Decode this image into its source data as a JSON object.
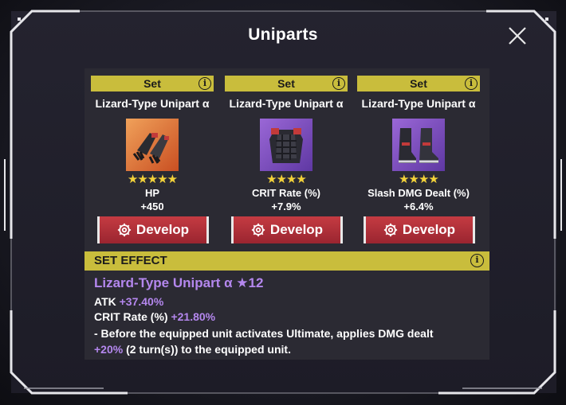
{
  "modal": {
    "title": "Uniparts",
    "close_icon": "close-icon"
  },
  "cards": [
    {
      "set_label": "Set",
      "name": "Lizard-Type Unipart α",
      "image": "gauntlet-icon",
      "stars": "★★★★★",
      "star_count": 5,
      "stat_name": "HP",
      "stat_value": "+450",
      "develop_label": "Develop"
    },
    {
      "set_label": "Set",
      "name": "Lizard-Type Unipart α",
      "image": "armor-icon",
      "stars": "★★★★",
      "star_count": 4,
      "stat_name": "CRIT Rate (%)",
      "stat_value": "+7.9%",
      "develop_label": "Develop"
    },
    {
      "set_label": "Set",
      "name": "Lizard-Type Unipart α",
      "image": "boots-icon",
      "stars": "★★★★",
      "star_count": 4,
      "stat_name": "Slash DMG Dealt (%)",
      "stat_value": "+6.4%",
      "develop_label": "Develop"
    }
  ],
  "set_effect": {
    "header": "SET EFFECT",
    "title": "Lizard-Type Unipart α ★12",
    "atk_label": "ATK",
    "atk_value": "+37.40%",
    "crit_label": "CRIT Rate (%)",
    "crit_value": "+21.80%",
    "desc_line1": "- Before the equipped unit activates Ultimate, applies DMG dealt",
    "desc_value": "+20%",
    "desc_line2_rest": "(2 turn(s)) to the equipped unit."
  },
  "colors": {
    "accent_yellow": "#c9bd3c",
    "stat_purple": "#b487ee",
    "button_red": "#c53b42",
    "star_gold": "#f3d23a"
  }
}
